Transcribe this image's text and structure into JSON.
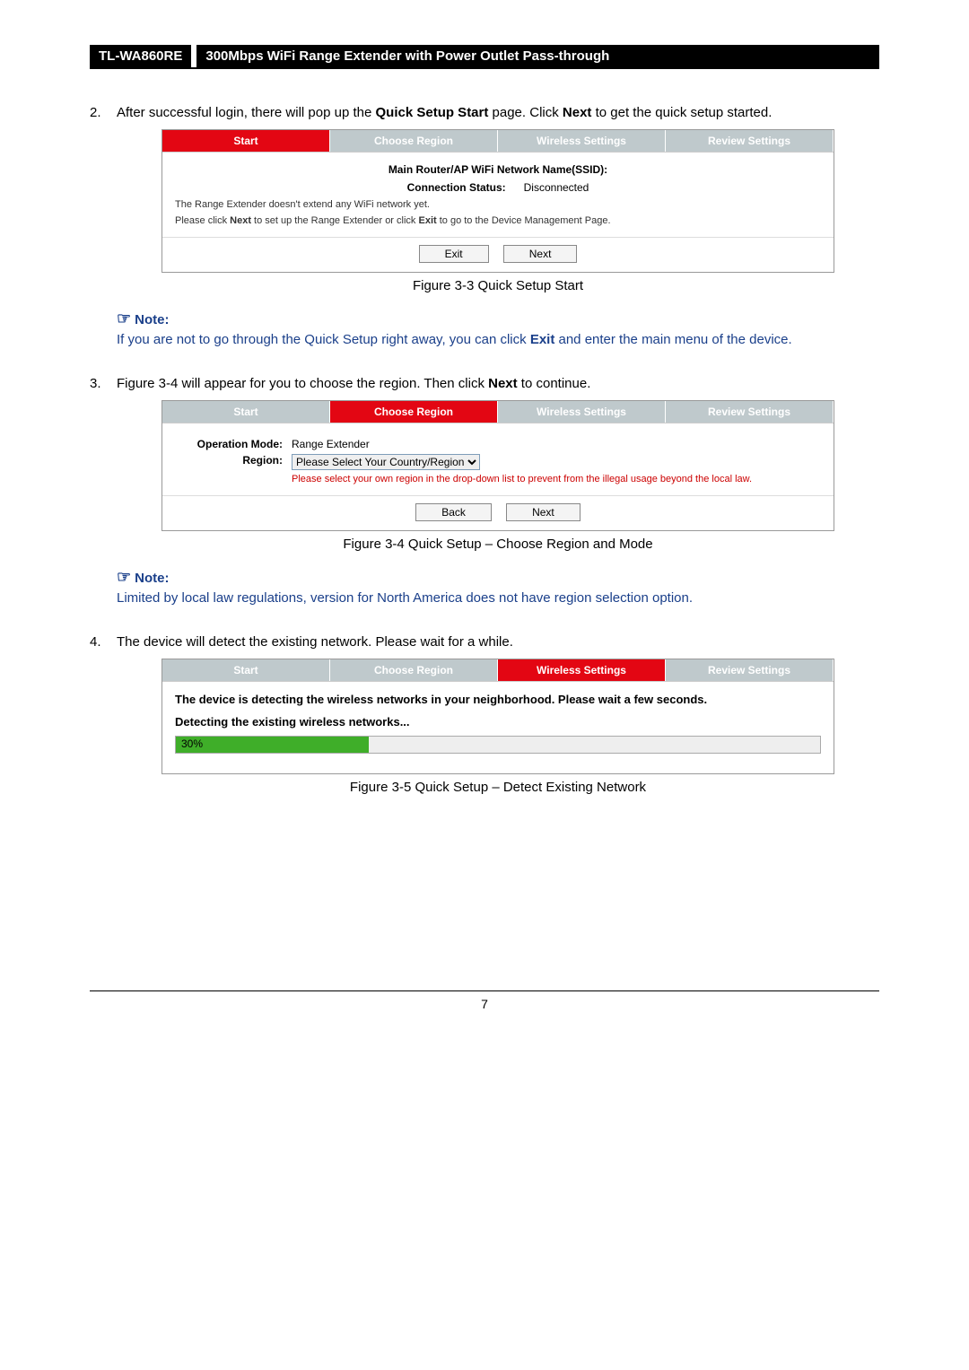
{
  "header": {
    "model": "TL-WA860RE",
    "desc": "300Mbps WiFi Range Extender with Power Outlet Pass-through"
  },
  "steps": {
    "s2": {
      "num": "2.",
      "text_a": "After successful login, there will pop up the ",
      "text_b": "Quick Setup Start",
      "text_c": " page. Click ",
      "text_d": "Next",
      "text_e": " to get the quick setup started."
    },
    "s3": {
      "num": "3.",
      "text_a": "Figure 3-4 will appear for you to choose the region. Then click ",
      "text_b": "Next",
      "text_c": " to continue."
    },
    "s4": {
      "num": "4.",
      "text": "The device will detect the existing network. Please wait for a while."
    }
  },
  "tabs": {
    "start": "Start",
    "region": "Choose Region",
    "wireless": "Wireless Settings",
    "review": "Review Settings"
  },
  "fig33": {
    "ssid_label": "Main Router/AP WiFi Network Name(SSID):",
    "conn_label": "Connection Status:",
    "conn_value": "Disconnected",
    "line1": "The Range Extender doesn't extend any WiFi network yet.",
    "line2a": "Please click ",
    "line2b": "Next",
    "line2c": " to set up the Range Extender or click ",
    "line2d": "Exit",
    "line2e": " to go to the Device Management Page.",
    "btn_exit": "Exit",
    "btn_next": "Next",
    "caption": "Figure 3-3 Quick Setup Start"
  },
  "note1": {
    "head": "Note:",
    "body_a": "If you are not to go through the Quick Setup right away, you can click ",
    "body_b": "Exit",
    "body_c": " and enter the main menu of the device."
  },
  "fig34": {
    "op_label": "Operation Mode:",
    "op_value": "Range Extender",
    "region_label": "Region:",
    "region_value": "Please Select Your Country/Region",
    "hint": "Please select your own region in the drop-down list to prevent from the illegal usage beyond the local law.",
    "btn_back": "Back",
    "btn_next": "Next",
    "caption": "Figure 3-4 Quick Setup – Choose Region and Mode"
  },
  "note2": {
    "head": "Note:",
    "body": "Limited by local law regulations, version for North America does not have region selection option."
  },
  "fig35": {
    "msg": "The device is detecting the wireless networks in your neighborhood. Please wait a few seconds.",
    "sub": "Detecting the existing wireless networks...",
    "pct": "30%",
    "pct_width": "30%",
    "caption": "Figure 3-5 Quick Setup – Detect Existing Network"
  },
  "footer": {
    "page": "7"
  }
}
